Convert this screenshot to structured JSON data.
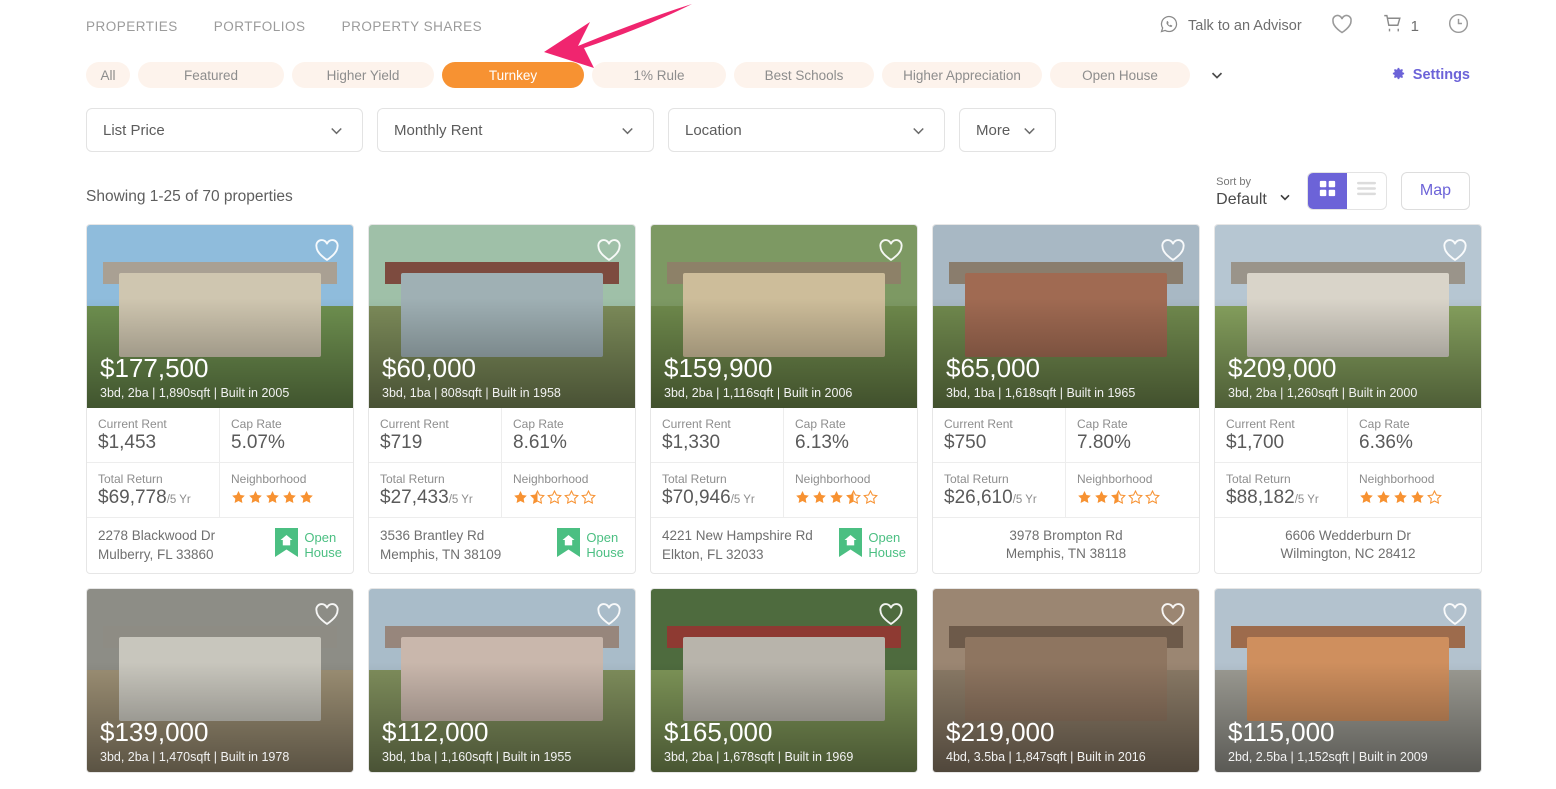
{
  "nav": {
    "links": [
      {
        "label": "PROPERTIES"
      },
      {
        "label": "PORTFOLIOS"
      },
      {
        "label": "PROPERTY SHARES"
      }
    ],
    "advisor_label": "Talk to an Advisor",
    "advisor_icon": "whatsapp-icon",
    "favorites_icon": "heart-icon",
    "cart_icon": "cart-icon",
    "cart_count": "1",
    "history_icon": "clock-icon"
  },
  "pills": {
    "items": [
      {
        "label": "All",
        "active": false
      },
      {
        "label": "Featured",
        "active": false
      },
      {
        "label": "Higher Yield",
        "active": false
      },
      {
        "label": "Turnkey",
        "active": true
      },
      {
        "label": "1% Rule",
        "active": false
      },
      {
        "label": "Best Schools",
        "active": false
      },
      {
        "label": "Higher Appreciation",
        "active": false
      },
      {
        "label": "Open House",
        "active": false
      }
    ],
    "expand_icon": "chevron-down-icon",
    "settings_label": "Settings",
    "settings_icon": "gear-icon",
    "active_color": "#f79232",
    "settings_color": "#6c63d8"
  },
  "filters": [
    {
      "label": "List Price"
    },
    {
      "label": "Monthly Rent"
    },
    {
      "label": "Location"
    },
    {
      "label": "More"
    }
  ],
  "results": {
    "showing": "Showing 1-25 of 70 properties",
    "sort_by_label": "Sort by",
    "sort_by_value": "Default",
    "grid_icon": "grid-view-icon",
    "list_icon": "list-view-icon",
    "map_label": "Map",
    "accent_color": "#6c63d8"
  },
  "labels": {
    "current_rent": "Current Rent",
    "cap_rate": "Cap Rate",
    "total_return": "Total Return",
    "neighborhood": "Neighborhood",
    "return_suffix": "/5 Yr",
    "open_house": "Open\nHouse",
    "open_house_line1": "Open",
    "open_house_line2": "House",
    "open_house_icon": "house-ribbon-icon",
    "favorite_icon": "heart-icon",
    "star_color": "#f79232",
    "open_house_color": "#4bbf82"
  },
  "properties": [
    {
      "price": "$177,500",
      "specs": "3bd, 2ba | 1,890sqft | Built in 2005",
      "current_rent": "$1,453",
      "cap_rate": "5.07%",
      "total_return": "$69,778",
      "stars": 5,
      "address_line1": "2278 Blackwood Dr",
      "address_line2": "Mulberry, FL 33860",
      "open_house": true,
      "sky": "#8fbcdc",
      "ground": "#6f9150",
      "house": "#cfc6b0",
      "roof": "#a9a093"
    },
    {
      "price": "$60,000",
      "specs": "3bd, 1ba | 808sqft | Built in 1958",
      "current_rent": "$719",
      "cap_rate": "8.61%",
      "total_return": "$27,433",
      "stars": 1.5,
      "address_line1": "3536 Brantley Rd",
      "address_line2": "Memphis, TN 38109",
      "open_house": true,
      "sky": "#9fc0a8",
      "ground": "#7d8c5a",
      "house": "#9fb0b4",
      "roof": "#7d4b3f"
    },
    {
      "price": "$159,900",
      "specs": "3bd, 2ba | 1,116sqft | Built in 2006",
      "current_rent": "$1,330",
      "cap_rate": "6.13%",
      "total_return": "$70,946",
      "stars": 3.5,
      "address_line1": "4221 New Hampshire Rd",
      "address_line2": "Elkton, FL 32033",
      "open_house": true,
      "sky": "#7d9963",
      "ground": "#6f8a4c",
      "house": "#cdbd9a",
      "roof": "#8d8168"
    },
    {
      "price": "$65,000",
      "specs": "3bd, 1ba | 1,618sqft | Built in 1965",
      "current_rent": "$750",
      "cap_rate": "7.80%",
      "total_return": "$26,610",
      "stars": 2.5,
      "address_line1": "3978 Brompton Rd",
      "address_line2": "Memphis, TN 38118",
      "open_house": false,
      "sky": "#a8b8c4",
      "ground": "#718a4e",
      "house": "#a06a52",
      "roof": "#8a7d6d"
    },
    {
      "price": "$209,000",
      "specs": "3bd, 2ba | 1,260sqft | Built in 2000",
      "current_rent": "$1,700",
      "cap_rate": "6.36%",
      "total_return": "$88,182",
      "stars": 4,
      "address_line1": "6606 Wedderburn Dr",
      "address_line2": "Wilmington, NC 28412",
      "open_house": false,
      "sky": "#b6c6d2",
      "ground": "#86a15e",
      "house": "#d9d4c9",
      "roof": "#9a948a"
    },
    {
      "price": "$139,000",
      "specs": "3bd, 2ba | 1,470sqft | Built in 1978",
      "current_rent": "",
      "cap_rate": "",
      "total_return": "",
      "stars": 0,
      "address_line1": "",
      "address_line2": "",
      "open_house": false,
      "sky": "#8d8d86",
      "ground": "#9c8f74",
      "house": "#c8c6bd",
      "roof": "#8e8c84"
    },
    {
      "price": "$112,000",
      "specs": "3bd, 1ba | 1,160sqft | Built in 1955",
      "current_rent": "",
      "cap_rate": "",
      "total_return": "",
      "stars": 0,
      "address_line1": "",
      "address_line2": "",
      "open_house": false,
      "sky": "#a9bcc9",
      "ground": "#7f8e5c",
      "house": "#c9b7ac",
      "roof": "#97867c"
    },
    {
      "price": "$165,000",
      "specs": "3bd, 2ba | 1,678sqft | Built in 1969",
      "current_rent": "",
      "cap_rate": "",
      "total_return": "",
      "stars": 0,
      "address_line1": "",
      "address_line2": "",
      "open_house": false,
      "sky": "#4e6b3e",
      "ground": "#7d9457",
      "house": "#b8b4ab",
      "roof": "#8e3a32"
    },
    {
      "price": "$219,000",
      "specs": "4bd, 3.5ba | 1,847sqft | Built in 2016",
      "current_rent": "",
      "cap_rate": "",
      "total_return": "",
      "stars": 0,
      "address_line1": "",
      "address_line2": "",
      "open_house": false,
      "sky": "#9b8672",
      "ground": "#8a7a66",
      "house": "#8e7560",
      "roof": "#6d5a4a"
    },
    {
      "price": "$115,000",
      "specs": "2bd, 2.5ba | 1,152sqft | Built in 2009",
      "current_rent": "",
      "cap_rate": "",
      "total_return": "",
      "stars": 0,
      "address_line1": "",
      "address_line2": "",
      "open_house": false,
      "sky": "#b3c2ce",
      "ground": "#9c9b93",
      "house": "#cf8f5e",
      "roof": "#9d6b4c"
    }
  ],
  "annotation": {
    "arrow_color": "#f0256f",
    "arrow_icon": "pink-arrow-annotation"
  }
}
